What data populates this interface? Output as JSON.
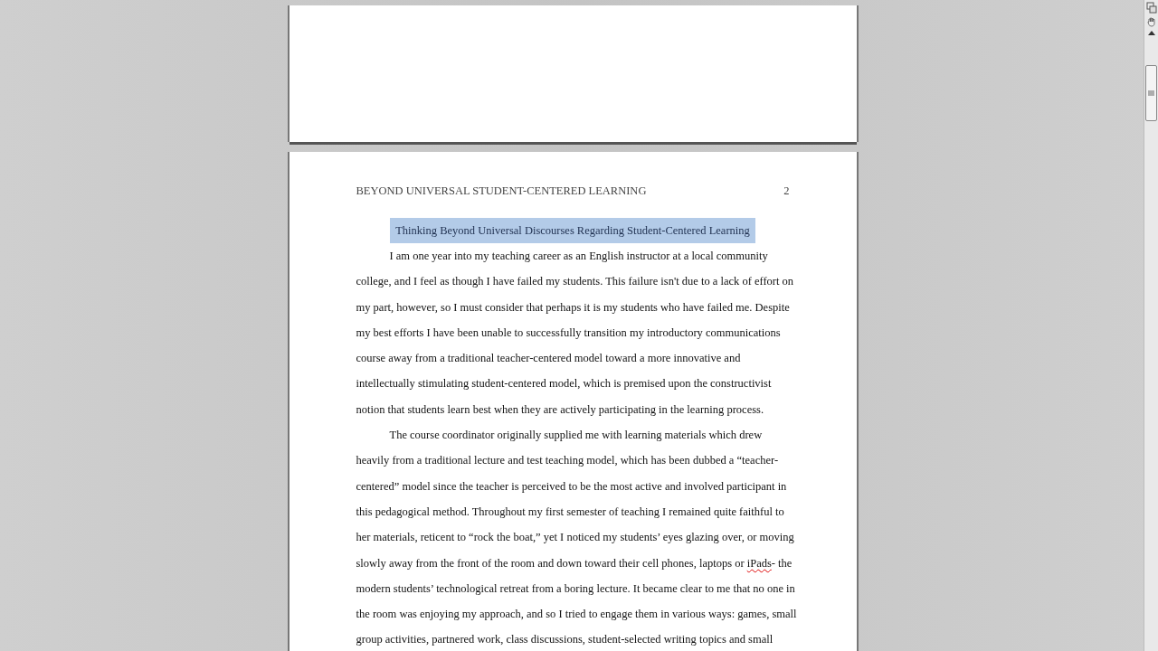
{
  "document": {
    "pages": [
      {
        "kind": "blank"
      },
      {
        "kind": "text",
        "header": {
          "running_head": "BEYOND UNIVERSAL STUDENT-CENTERED LEARNING",
          "page_number": "2"
        },
        "title": {
          "text": "Thinking Beyond Universal Discourses Regarding Student-Centered Learning",
          "selected": true
        },
        "paragraphs": [
          {
            "lines": [
              "I am one year into my teaching career as an English instructor at a local community",
              "college, and I feel as though I have failed my students. This failure isn't due to a lack of effort on",
              "my part, however, so I must consider that perhaps it is my students who have failed me. Despite",
              "my best efforts I have been unable to successfully transition my introductory communications",
              "course away from a traditional teacher-centered model toward a more innovative and",
              "intellectually stimulating student-centered model, which is premised upon the constructivist",
              "notion that students learn best when they are actively participating in the learning process."
            ]
          },
          {
            "lines": [
              "The course coordinator originally supplied me with learning materials which drew",
              "heavily from a traditional lecture and test teaching model, which has been dubbed a “teacher-",
              "centered” model since the teacher is perceived to be the most active and involved participant in",
              "this pedagogical method. Throughout my first semester of teaching I remained quite faithful to",
              "her materials, reticent to “rock the boat,” yet I noticed my students’ eyes glazing over, or moving",
              [
                {
                  "text": "slowly away from the front of the room and down toward their cell phones, laptops or ",
                  "misspelled": false
                },
                {
                  "text": "iPads",
                  "misspelled": true
                },
                {
                  "text": "- the",
                  "misspelled": false
                }
              ],
              "modern students’ technological retreat from a boring lecture.  It became clear to me that no one in",
              "the room was enjoying my approach, and so I tried to engage them in various ways: games, small",
              "group activities, partnered work, class discussions, student-selected writing topics and small"
            ]
          }
        ]
      }
    ]
  }
}
